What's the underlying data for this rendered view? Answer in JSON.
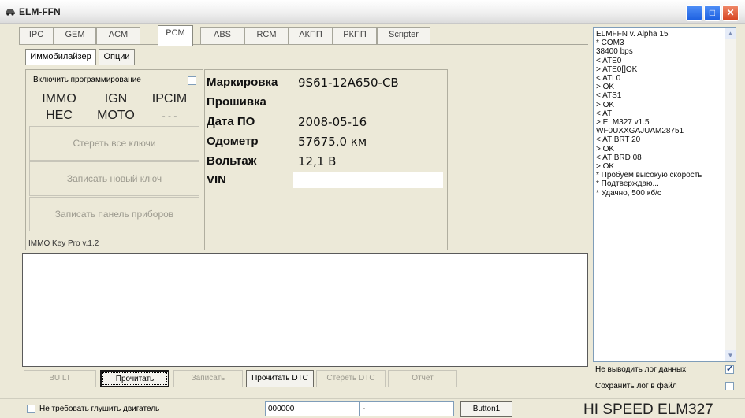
{
  "window": {
    "title": "ELM-FFN"
  },
  "tabs": [
    "IPC",
    "GEM",
    "ACM",
    "PCM",
    "ABS",
    "RCM",
    "АКПП",
    "РКПП",
    "Scripter"
  ],
  "active_tab": "PCM",
  "subtabs": [
    "Иммобилайзер",
    "Опции"
  ],
  "immo": {
    "enable_programming": "Включить программирование",
    "buttons_row1": [
      "IMMO",
      "IGN",
      "IPCIM"
    ],
    "buttons_row2": [
      "HEC",
      "MOTO",
      "- - -"
    ],
    "erase_keys": "Стереть все ключи",
    "write_new_key": "Записать новый ключ",
    "write_panel": "Записать панель приборов",
    "version": "IMMO Key Pro v.1.2"
  },
  "info": {
    "labels": [
      "Маркировка",
      "Прошивка",
      "Дата ПО",
      "Одометр",
      "Вольтаж",
      "VIN"
    ],
    "values": [
      "9S61-12A650-CB",
      "",
      "2008-05-16",
      "57675,0 км",
      "12,1 В",
      ""
    ]
  },
  "bottom_buttons": [
    "BUILT",
    "Прочитать",
    "Записать",
    "Прочитать DTC",
    "Стереть DTC",
    "Отчет"
  ],
  "log_lines": [
    "ELMFFN v. Alpha 15",
    "* COM3",
    "38400 bps",
    "< ATE0",
    "> ATE0[]OK",
    "< ATL0",
    "> OK",
    "< ATS1",
    "> OK",
    "< ATI",
    "> ELM327 v1.5",
    "WF0UXXGAJUAM28751",
    "< AT BRT 20",
    "> OK",
    "< AT BRD 08",
    "> OK",
    "* Пробуем высокую скорость",
    "* Подтверждаю...",
    "* Удачно, 500 кб/с"
  ],
  "log_options": {
    "no_output": "Не выводить лог данных",
    "save_file": "Сохранить лог в файл"
  },
  "status": {
    "no_engine_stop": "Не требовать глушить двигатель",
    "field1": "000000",
    "field2": "-",
    "button1": "Button1",
    "hi_speed": "HI SPEED ELM327"
  }
}
